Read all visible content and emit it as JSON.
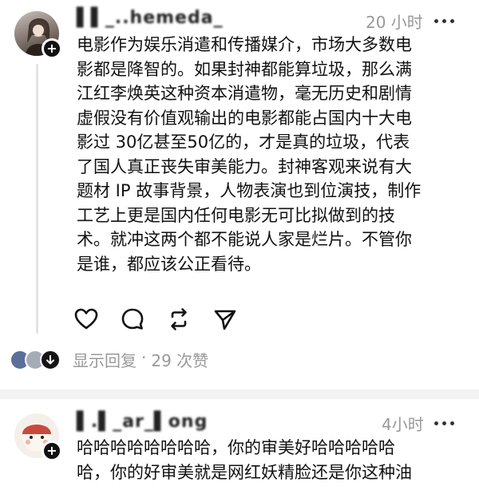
{
  "posts": [
    {
      "username": "▌▌_..hemeda_",
      "timestamp": "20 小时",
      "lines": [
        "电影作为娱乐消遣和传播媒介，市场大多数电",
        "影都是降智的。如果封神都能算垃圾，那么满",
        "江红李焕英这种资本消遣物，毫无历史和剧情",
        "虚假没有价值观输出的电影都能占国内十大电",
        "影过 30亿甚至50亿的，才是真的垃圾，代表",
        "了国人真正丧失审美能力。封神客观来说有大",
        "题材 IP 故事背景，人物表演也到位演技，制作",
        "工艺上更是国内任何电影无可比拟做到的技",
        "术。就冲这两个都不能说人家是烂片。不管你",
        "是谁，都应该公正看待。"
      ],
      "reply_label": "显示回复",
      "dot": "·",
      "likes": "29 次赞"
    },
    {
      "username": "▌.▌_ar_▌ong",
      "timestamp": "4小时",
      "lines": [
        "哈哈哈哈哈哈哈哈，你的审美好哈哈哈哈哈",
        "哈，你的好审美就是网红妖精脸还是你这种油"
      ]
    }
  ],
  "icons": {
    "like": "heart-icon",
    "comment": "comment-icon",
    "repost": "repost-icon",
    "share": "send-icon",
    "more": "more-icon",
    "follow": "plus-icon"
  },
  "colors": {
    "meta_text": "#999999",
    "body_text": "#111111",
    "thread_line": "#e3e3e3"
  }
}
